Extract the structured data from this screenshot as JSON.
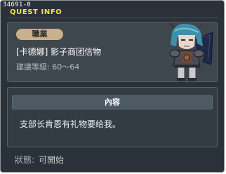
{
  "header": {
    "quest_id": "34691-0",
    "title": "QUEST INFO"
  },
  "npc": {
    "job_label": "職業",
    "name": "[卡德娜] 影子商团信物",
    "recommended_level": "建議等級: 60～64",
    "portrait_icon": "npc-demon-warrior-portrait"
  },
  "content": {
    "header": "內容",
    "text": "支部长肯恩有礼物要给我。"
  },
  "status": {
    "label": "狀態:",
    "value": "可開始"
  },
  "colors": {
    "title_accent": "#f7e34e",
    "panel_bg": "#2a3138",
    "job_tab": "#c7b08a"
  }
}
